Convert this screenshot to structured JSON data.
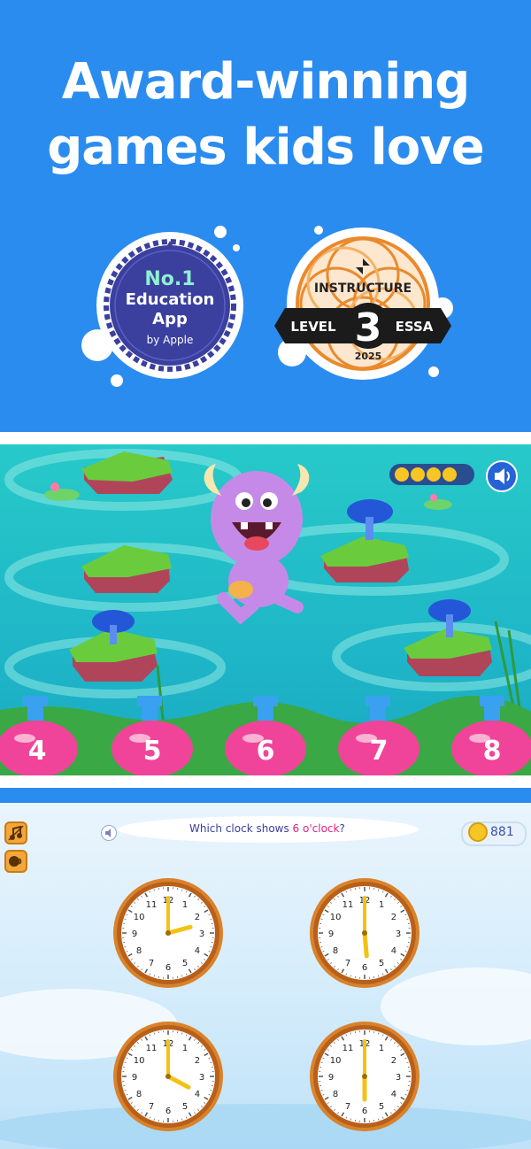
{
  "hero": {
    "headline_line1": "Award-winning",
    "headline_line2": "games kids love",
    "badge_apple": {
      "line1": "No.1",
      "line2": "Education",
      "line3": "App",
      "line4": "by Apple"
    },
    "badge_essa": {
      "brand": "INSTRUCTURE",
      "left": "LEVEL",
      "number": "3",
      "right": "ESSA",
      "year": "2025"
    }
  },
  "game1": {
    "flasks": [
      "4",
      "5",
      "6",
      "7",
      "8"
    ],
    "progress_coins": 4,
    "sound_icon": "speaker-icon"
  },
  "game2": {
    "question_prefix": "Which clock shows ",
    "question_highlight": "6 o'clock",
    "question_suffix": "?",
    "coin_count": "881",
    "clock_numbers": [
      "12",
      "1",
      "2",
      "3",
      "4",
      "5",
      "6",
      "7",
      "8",
      "9",
      "10",
      "11"
    ]
  },
  "colors": {
    "brand_blue": "#2b8cf0",
    "badge_navy": "#3b3f9e",
    "badge_mint": "#8ff0d0",
    "flask_pink": "#f0449a",
    "clock_rim": "#d9822b",
    "hand_yellow": "#f3c214"
  }
}
